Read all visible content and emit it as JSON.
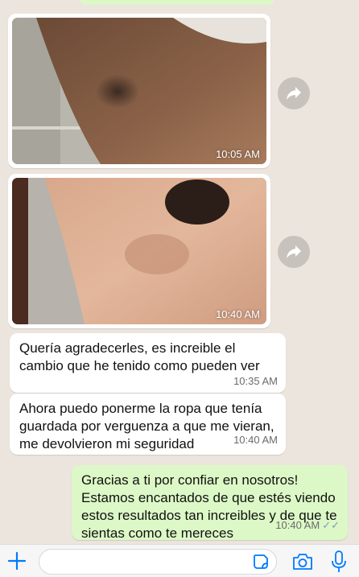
{
  "messages": {
    "photo1": {
      "time": "10:05 AM"
    },
    "photo2": {
      "time": "10:40 AM"
    },
    "msg1": {
      "lines": [
        "Quería agradecerles, es increible el",
        "cambio que he tenido como pueden ver"
      ],
      "time": "10:35 AM"
    },
    "msg2": {
      "lines": [
        "Ahora puedo ponerme la ropa que tenía",
        "guardada por verguenza a que me vieran,",
        "me devolvieron mi seguridad"
      ],
      "time": "10:40 AM"
    },
    "msg3": {
      "lines": [
        "Gracias a ti por confiar en nosotros!",
        "Estamos encantados de que estés viendo",
        "estos resultados tan increibles y de que te",
        "sientas como te mereces"
      ],
      "time": "10:40 AM"
    }
  },
  "composer": {
    "placeholder": ""
  },
  "icons": {
    "forward": "forward-arrow-icon",
    "plus": "plus-icon",
    "sticker": "sticker-icon",
    "camera": "camera-icon",
    "mic": "microphone-icon",
    "read_ticks": "double-check-icon"
  },
  "colors": {
    "chat_bg": "#ece5dd",
    "incoming": "#ffffff",
    "outgoing": "#dcf8c6",
    "accent": "#007aff",
    "ticks": "#7b9db5"
  }
}
